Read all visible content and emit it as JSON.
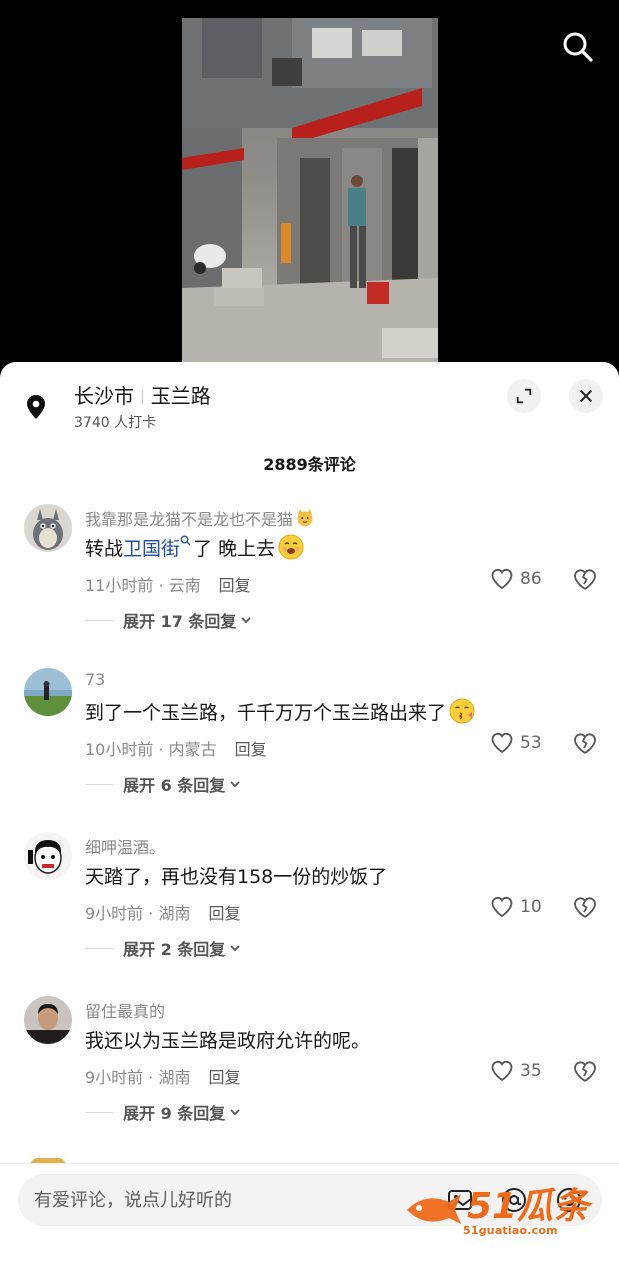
{
  "search": {
    "icon": "search-icon"
  },
  "location": {
    "city": "长沙市",
    "road": "玉兰路",
    "checkins": "3740 人打卡"
  },
  "comments_header": {
    "count_label": "2889条评论"
  },
  "comments": [
    {
      "username": "我靠那是龙猫不是龙也不是猫",
      "text_prefix": "转战",
      "text_link": "卫国街",
      "text_suffix": "了 晚上去",
      "meta": "11小时前 · 云南",
      "reply_label": "回复",
      "likes": "86",
      "expand_label": "展开 17 条回复"
    },
    {
      "username": "73",
      "text": "到了一个玉兰路，千千万万个玉兰路出来了",
      "meta": "10小时前 · 内蒙古",
      "reply_label": "回复",
      "likes": "53",
      "expand_label": "展开 6 条回复"
    },
    {
      "username": "细呷温酒。",
      "text": "天踏了，再也没有158一份的炒饭了",
      "meta": "9小时前 · 湖南",
      "reply_label": "回复",
      "likes": "10",
      "expand_label": "展开 2 条回复"
    },
    {
      "username": "留住最真的",
      "text": "我还以为玉兰路是政府允许的呢。",
      "meta": "9小时前 · 湖南",
      "reply_label": "回复",
      "likes": "35",
      "expand_label": "展开 9 条回复"
    }
  ],
  "input": {
    "placeholder": "有爱评论，说点儿好听的"
  },
  "watermark": {
    "text": "51瓜条",
    "url": "51guatiao.com"
  },
  "colors": {
    "link": "#1e4fa0",
    "watermark": "#ef6a1a",
    "awning": "#b8201c"
  }
}
